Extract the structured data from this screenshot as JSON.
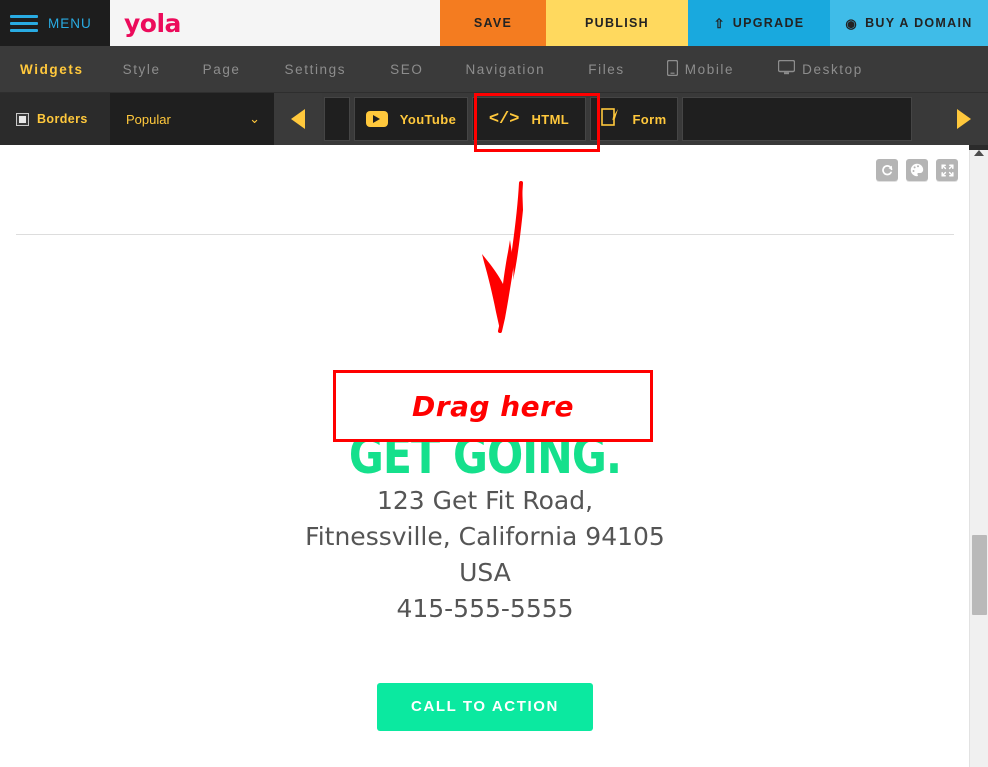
{
  "topbar": {
    "menu_label": "MENU",
    "menu_icon": "hamburger-icon",
    "logo_text": "yola",
    "save_label": "SAVE",
    "publish_label": "PUBLISH",
    "upgrade_label": "UPGRADE",
    "upgrade_icon": "⇧",
    "domain_label": "BUY A DOMAIN",
    "domain_icon": "◉",
    "colors": {
      "menu_bg": "#1d1d1d",
      "menu_text": "#29ABE2",
      "logo": "#EC0B5B",
      "save_bg": "#F47C20",
      "publish_bg": "#FFD95E",
      "upgrade_bg": "#19A9DE",
      "domain_bg": "#3FBCE8"
    }
  },
  "nav": {
    "items": [
      {
        "label": "Widgets",
        "active": true,
        "icon": ""
      },
      {
        "label": "Style",
        "active": false,
        "icon": ""
      },
      {
        "label": "Page",
        "active": false,
        "icon": ""
      },
      {
        "label": "Settings",
        "active": false,
        "icon": ""
      },
      {
        "label": "SEO",
        "active": false,
        "icon": ""
      },
      {
        "label": "Navigation",
        "active": false,
        "icon": ""
      },
      {
        "label": "Files",
        "active": false,
        "icon": ""
      },
      {
        "label": "Mobile",
        "active": false,
        "icon": "mobile-phone-icon"
      },
      {
        "label": "Desktop",
        "active": false,
        "icon": "desktop-monitor-icon"
      }
    ],
    "active_color": "#FFC83C",
    "inactive_color": "#8d8d8d"
  },
  "widget_toolbar": {
    "borders_label": "Borders",
    "borders_checked": false,
    "category_label": "Popular",
    "category_chevron": "⌄",
    "prev_arrow_icon": "triangle-left-icon",
    "next_arrow_icon": "triangle-right-icon",
    "widgets": [
      {
        "label": "YouTube",
        "icon": "youtube-play-icon"
      },
      {
        "label": "HTML",
        "icon": "code-brackets-icon",
        "highlighted": true
      },
      {
        "label": "Form",
        "icon": "form-pencil-icon"
      }
    ],
    "highlight_color": "#FF0000",
    "accent_color": "#FFC83C"
  },
  "canvas": {
    "page_tools": [
      {
        "icon": "refresh-icon",
        "glyph": "↻"
      },
      {
        "icon": "palette-icon",
        "glyph": "◔"
      },
      {
        "icon": "fullscreen-icon",
        "glyph": "⤢"
      }
    ],
    "headline": "GET GOING.",
    "headline_color": "#15E08C",
    "annotation": {
      "drag_here_label": "Drag here",
      "annotation_color": "#FF0000",
      "arrow_icon": "hand-drawn-down-arrow-icon"
    },
    "address_lines": [
      "123 Get Fit Road,",
      "Fitnessville, California 94105",
      "USA",
      "415-555-5555"
    ],
    "cta_label": "CALL TO ACTION",
    "cta_color": "#0BE9A0"
  },
  "scrollbar": {
    "up_arrow_icon": "scroll-up-arrow-icon",
    "thumb_label": "vertical-scroll-thumb"
  }
}
